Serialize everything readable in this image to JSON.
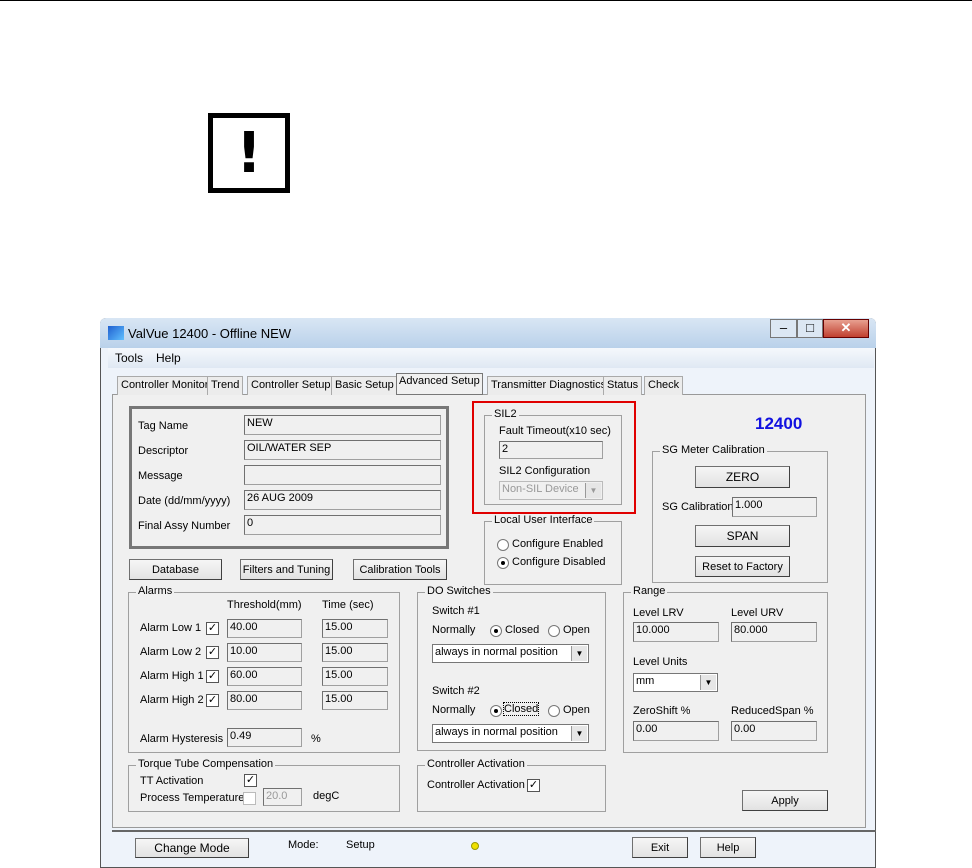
{
  "window": {
    "title": "ValVue 12400 - Offline  NEW",
    "menu": [
      "Tools",
      "Help"
    ]
  },
  "tabs": [
    "Controller Monitor",
    "Trend",
    "Controller Setup",
    "Basic Setup",
    "Advanced Setup",
    "Transmitter Diagnostics",
    "Status",
    "Check"
  ],
  "active_tab": "Advanced Setup",
  "info": {
    "tag_name_label": "Tag Name",
    "tag_name": "NEW",
    "descriptor_label": "Descriptor",
    "descriptor": "OIL/WATER SEP",
    "message_label": "Message",
    "message": "",
    "date_label": "Date (dd/mm/yyyy)",
    "date": "26 AUG 2009",
    "final_assy_label": "Final Assy Number",
    "final_assy": "0"
  },
  "buttons": {
    "database": "Database",
    "filters": "Filters and Tuning",
    "calibration": "Calibration Tools",
    "zero": "ZERO",
    "span": "SPAN",
    "reset": "Reset to Factory",
    "apply": "Apply",
    "change_mode": "Change Mode",
    "exit": "Exit",
    "help": "Help"
  },
  "sil2": {
    "title": "SIL2",
    "fault_label": "Fault Timeout(x10 sec)",
    "fault_value": "2",
    "config_label": "SIL2 Configuration",
    "config_value": "Non-SIL Device",
    "highlight_color": "#e00000"
  },
  "model": {
    "number": "12400",
    "color": "#1010e0"
  },
  "lui": {
    "title": "Local User Interface",
    "enabled": "Configure Enabled",
    "disabled": "Configure Disabled",
    "selected": "disabled"
  },
  "sg": {
    "title": "SG Meter Calibration",
    "cal_label": "SG Calibration",
    "cal_value": "1.000"
  },
  "alarms": {
    "title": "Alarms",
    "threshold_header": "Threshold(mm)",
    "time_header": "Time (sec)",
    "rows": [
      {
        "label": "Alarm Low 1",
        "checked": true,
        "threshold": "40.00",
        "time": "15.00"
      },
      {
        "label": "Alarm Low 2",
        "checked": true,
        "threshold": "10.00",
        "time": "15.00"
      },
      {
        "label": "Alarm High 1",
        "checked": true,
        "threshold": "60.00",
        "time": "15.00"
      },
      {
        "label": "Alarm High 2",
        "checked": true,
        "threshold": "80.00",
        "time": "15.00"
      }
    ],
    "hysteresis_label": "Alarm Hysteresis",
    "hysteresis": "0.49",
    "hysteresis_unit": "%"
  },
  "do": {
    "title": "DO Switches",
    "sw1": "Switch #1",
    "sw2": "Switch #2",
    "normally": "Normally",
    "closed": "Closed",
    "open": "Open",
    "sw1_mode": "always in normal position",
    "sw2_mode": "always in normal position"
  },
  "range": {
    "title": "Range",
    "lrv_label": "Level LRV",
    "lrv": "10.000",
    "urv_label": "Level URV",
    "urv": "80.000",
    "units_label": "Level Units",
    "units": "mm",
    "zs_label": "ZeroShift %",
    "zs": "0.00",
    "rs_label": "ReducedSpan %",
    "rs": "0.00"
  },
  "tt": {
    "title": "Torque Tube Compensation",
    "activation_label": "TT Activation",
    "activation": true,
    "pt_label": "Process Temperature",
    "pt_checked": false,
    "pt_value": "20.0",
    "pt_unit": "degC"
  },
  "ca": {
    "title": "Controller Activation",
    "label": "Controller Activation",
    "checked": true
  },
  "status": {
    "mode_label": "Mode:",
    "mode": "Setup",
    "indicator_color": "#f0e000"
  }
}
